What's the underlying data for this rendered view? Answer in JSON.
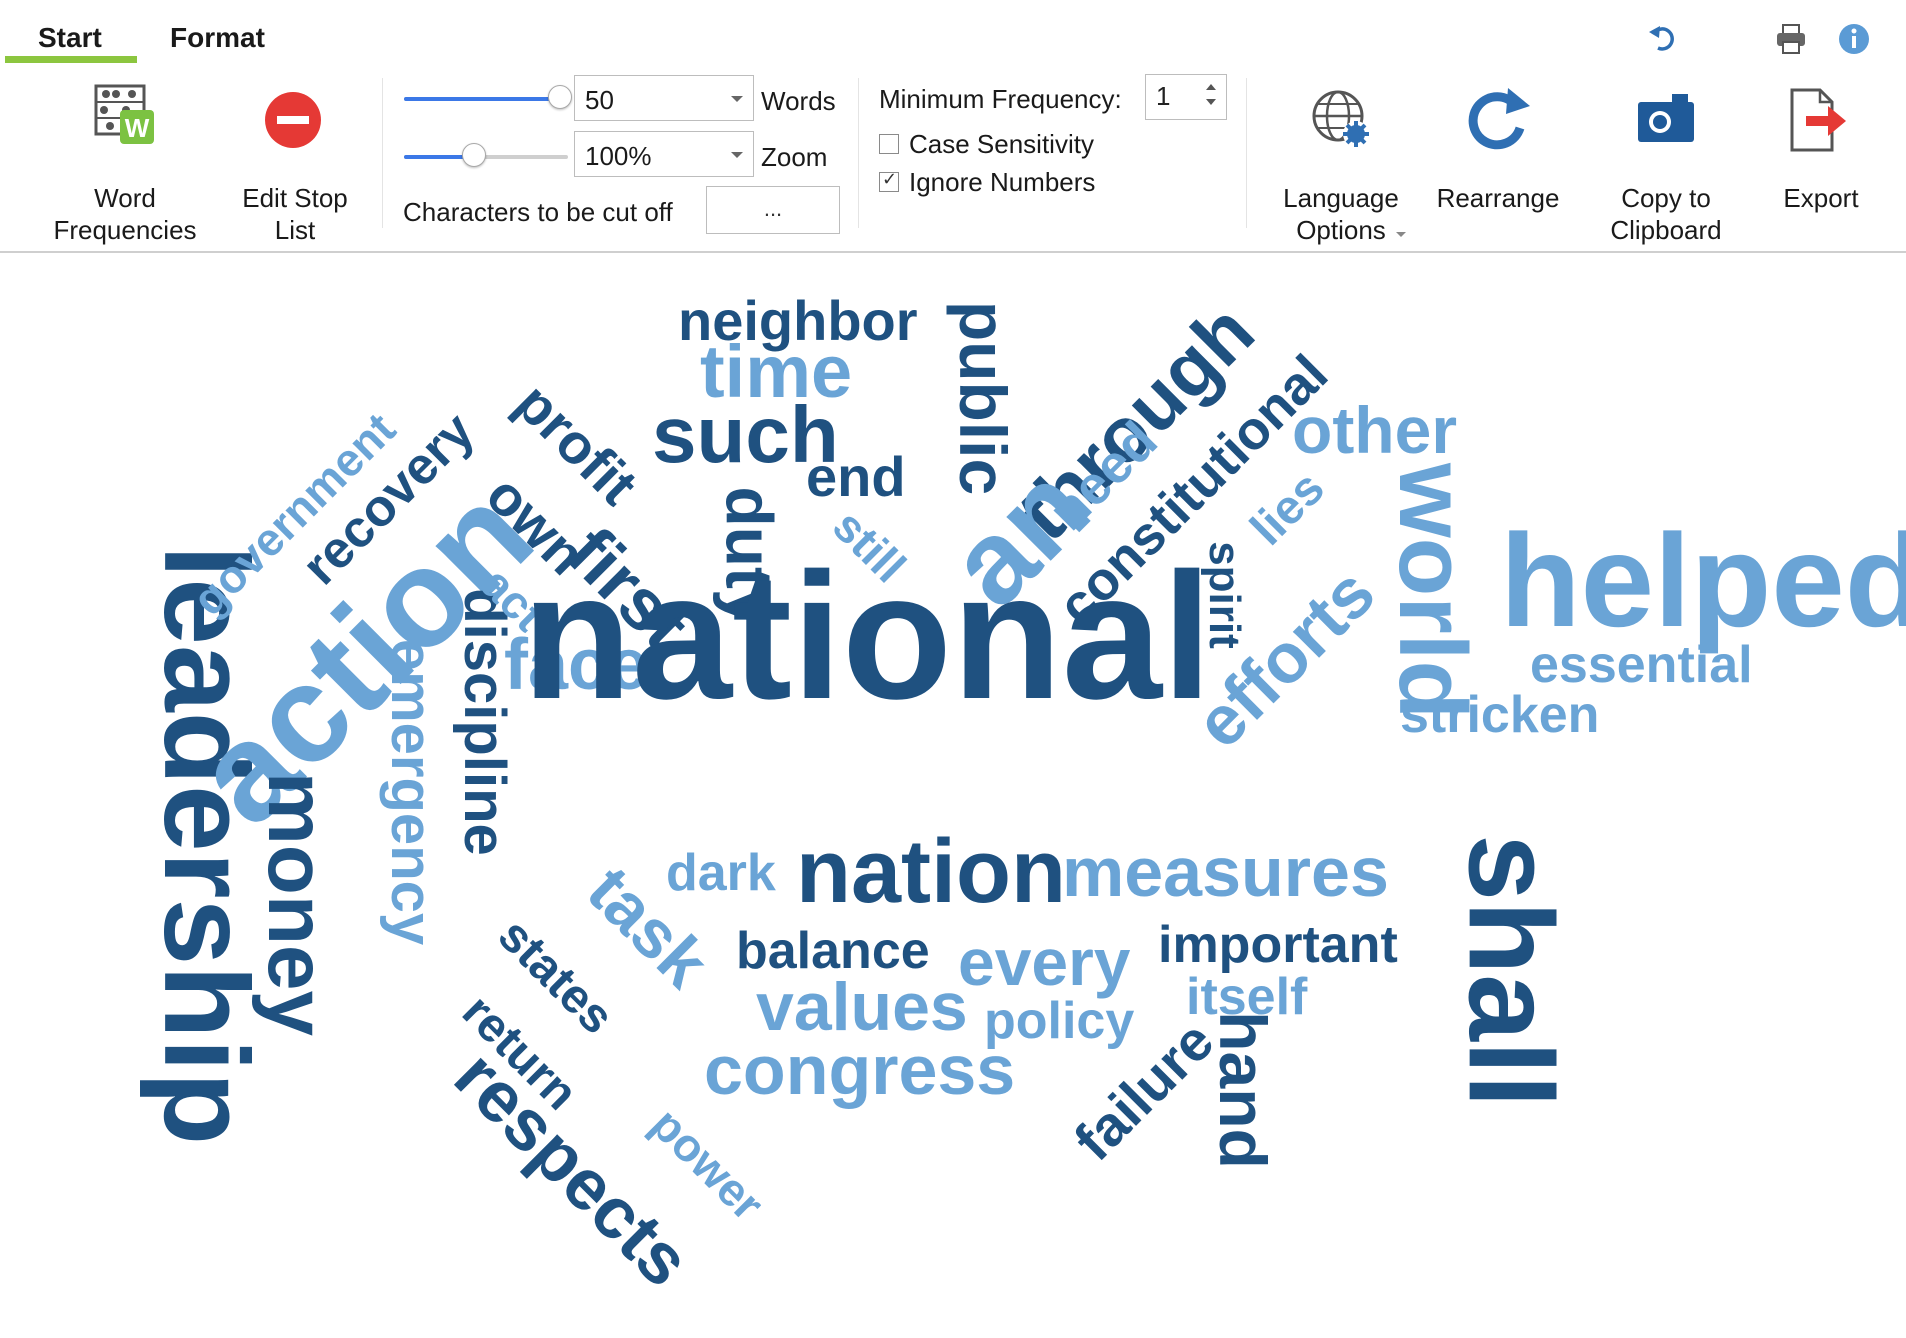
{
  "tabs": [
    {
      "label": "Start"
    },
    {
      "label": "Format"
    }
  ],
  "colors": {
    "accent_underline": "#8cc63f",
    "word_dark": "#1f5180",
    "word_light": "#6aa4d6",
    "slider": "#3b78e7"
  },
  "toolbar": {
    "word_frequencies": "Word Frequencies",
    "edit_stop_list": "Edit Stop List",
    "words_value": "50",
    "words_label": "Words",
    "zoom_value": "100%",
    "zoom_label": "Zoom",
    "chars_cut_label": "Characters to be cut off",
    "chars_cut_button": "...",
    "min_freq_label": "Minimum Frequency:",
    "min_freq_value": "1",
    "case_sensitivity": "Case Sensitivity",
    "case_sensitivity_checked": false,
    "ignore_numbers": "Ignore Numbers",
    "ignore_numbers_checked": true,
    "language_options": "Language Options",
    "rearrange": "Rearrange",
    "copy_to_clipboard": "Copy to Clipboard",
    "export": "Export",
    "words_slider_fraction": 0.98,
    "zoom_slider_fraction": 0.4
  },
  "icons": [
    "undo-icon",
    "print-icon",
    "info-icon",
    "word-frequencies-icon",
    "stop-icon",
    "globe-gear-icon",
    "rearrange-icon",
    "camera-icon",
    "export-icon"
  ],
  "cloud": {
    "words": [
      "national",
      "helped",
      "action",
      "leadership",
      "shall",
      "world",
      "nation",
      "measures",
      "money",
      "through",
      "an",
      "time",
      "such",
      "public",
      "face",
      "neighbor",
      "other",
      "constitutional",
      "emergency",
      "discipline",
      "important",
      "every",
      "values",
      "congress",
      "respects",
      "efforts",
      "essential",
      "stricken",
      "balance",
      "dark",
      "task",
      "states",
      "return",
      "power",
      "policy",
      "itself",
      "hand",
      "failure",
      "spirit",
      "lies",
      "still",
      "duty",
      "end",
      "need",
      "first",
      "own",
      "profit",
      "act",
      "recovery",
      "government"
    ]
  }
}
